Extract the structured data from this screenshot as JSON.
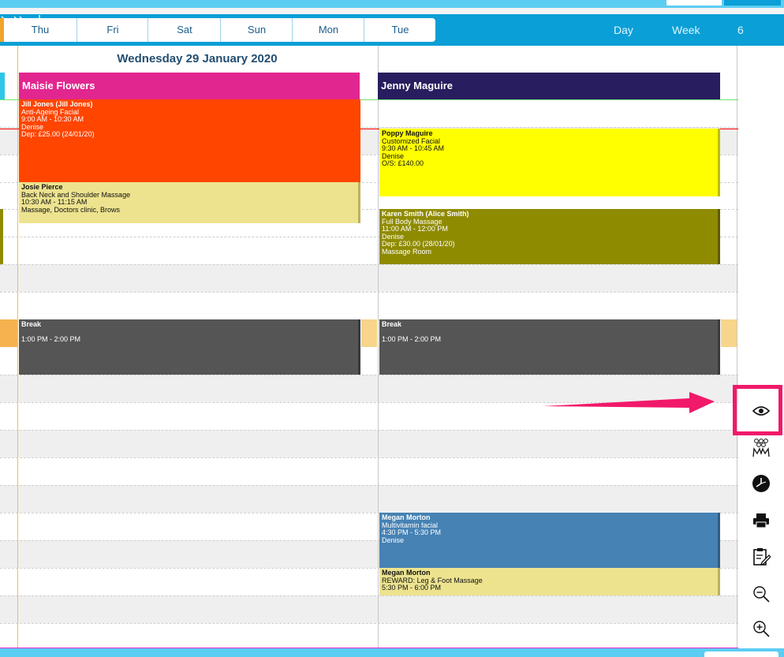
{
  "navbar": {
    "days": [
      "Thu",
      "Fri",
      "Sat",
      "Sun",
      "Mon",
      "Tue"
    ],
    "view_day_label": "Day",
    "view_week_label": "Week",
    "count_label": "6"
  },
  "calendar": {
    "date_title": "Wednesday 29 January 2020",
    "staff": [
      {
        "name": "Maisie Flowers",
        "color": "#e2268f"
      },
      {
        "name": "Jenny Maguire",
        "color": "#281d5e"
      }
    ],
    "appointments": [
      {
        "name": "Jill  Jones (Jill  Jones)",
        "l1": "Anti-Ageing Facial",
        "l2": "9:00 AM - 10:30 AM",
        "l3": "Denise",
        "l4": "Dep: £25.00 (24/01/20)",
        "l5": "",
        "color": "#ff4500"
      },
      {
        "name": "Josie Pierce",
        "l1": "Back Neck and Shoulder Massage",
        "l2": "10:30 AM - 11:15 AM",
        "l3": "Massage, Doctors clinic, Brows",
        "l4": "",
        "l5": "",
        "color": "#ede38f"
      },
      {
        "name": "Break",
        "l1": "",
        "l2": "1:00 PM - 2:00 PM",
        "l3": "",
        "l4": "",
        "l5": "",
        "color": "#555555"
      },
      {
        "name": "Poppy Maguire",
        "l1": "Customized Facial",
        "l2": "9:30 AM - 10:45 AM",
        "l3": "Denise",
        "l4": "O/S: £140.00",
        "l5": "",
        "color": "#ffff00"
      },
      {
        "name": "Karen  Smith (Alice Smith)",
        "l1": "Full Body Massage",
        "l2": "11:00 AM - 12:00 PM",
        "l3": "Denise",
        "l4": "Dep: £30.00 (28/01/20)",
        "l5": "Massage Room",
        "color": "#8f8b00"
      },
      {
        "name": "Break",
        "l1": "",
        "l2": "1:00 PM - 2:00 PM",
        "l3": "",
        "l4": "",
        "l5": "",
        "color": "#555555"
      },
      {
        "name": "Megan  Morton",
        "l1": "Multivitamin facial",
        "l2": "4:30 PM - 5:30 PM",
        "l3": "Denise",
        "l4": "",
        "l5": "",
        "color": "#4682b4"
      },
      {
        "name": "Megan  Morton",
        "l1": "REWARD: Leg & Foot Massage",
        "l2": "5:30 PM - 6:00 PM",
        "l3": "",
        "l4": "",
        "l5": "",
        "color": "#ede38f"
      }
    ]
  },
  "sidebar_icons": [
    "eye-icon",
    "group-icon",
    "clock-icon",
    "printer-icon",
    "notes-icon",
    "zoom-out-icon",
    "zoom-in-icon"
  ],
  "colors": {
    "accent": "#0a9fd6",
    "highlight": "#f1196a",
    "now_line": "#ff0000"
  }
}
